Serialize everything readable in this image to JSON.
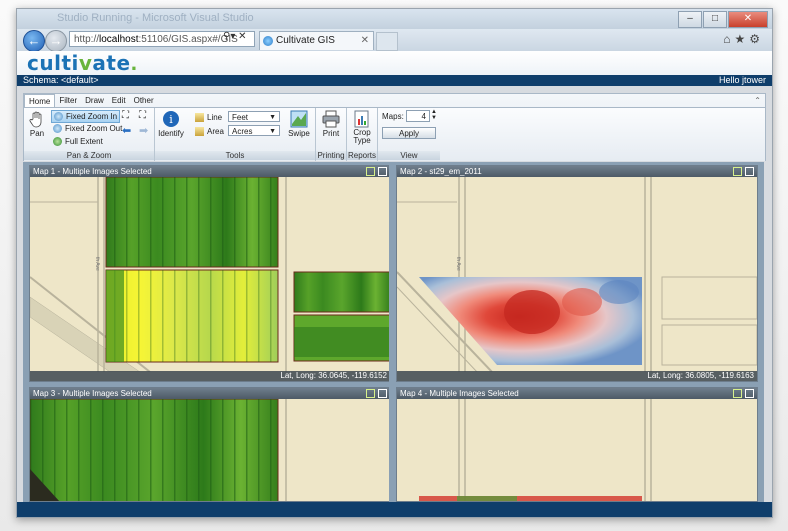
{
  "browser": {
    "title_ghost": "Studio Running - Microsoft Visual Studio",
    "address_prefix": "http://",
    "address_host": "localhost",
    "address_rest": ":51106/GIS.aspx#/GIS",
    "tab_title": "Cultivate GIS"
  },
  "app": {
    "logo_main": "culti",
    "logo_v": "v",
    "logo_rest": "ate",
    "logo_dot": ".",
    "schema": "Schema: <default>",
    "greeting": "Hello jtower"
  },
  "ribbon": {
    "tabs": [
      "Home",
      "Filter",
      "Draw",
      "Edit",
      "Other"
    ],
    "pan_label": "Pan",
    "fixed_zoom_in": "Fixed Zoom In",
    "fixed_zoom_out": "Fixed Zoom Out",
    "full_extent": "Full Extent",
    "group_pan_zoom": "Pan & Zoom",
    "identify": "Identify",
    "line_label": "Line",
    "area_label": "Area",
    "line_unit": "Feet",
    "area_unit": "Acres",
    "swipe": "Swipe",
    "group_tools": "Tools",
    "print": "Print",
    "group_printing": "Printing",
    "crop_type_1": "Crop",
    "crop_type_2": "Type",
    "group_reports": "Reports",
    "maps_label": "Maps:",
    "maps_value": "4",
    "apply": "Apply",
    "group_view": "View"
  },
  "maps": [
    {
      "title": "Map 1 - Multiple Images Selected",
      "coords": "Lat, Long: 36.0645, -119.6152",
      "road_label": "th Ave"
    },
    {
      "title": "Map 2 - st29_em_2011",
      "coords": "Lat, Long: 36.0805, -119.6163",
      "road_label": "th Ave"
    },
    {
      "title": "Map 3 - Multiple Images Selected"
    },
    {
      "title": "Map 4 - Multiple Images Selected"
    }
  ],
  "colors": {
    "brand_blue": "#1b72b5",
    "header_dark": "#0f3e6b",
    "map_ground": "#eee6c8"
  }
}
